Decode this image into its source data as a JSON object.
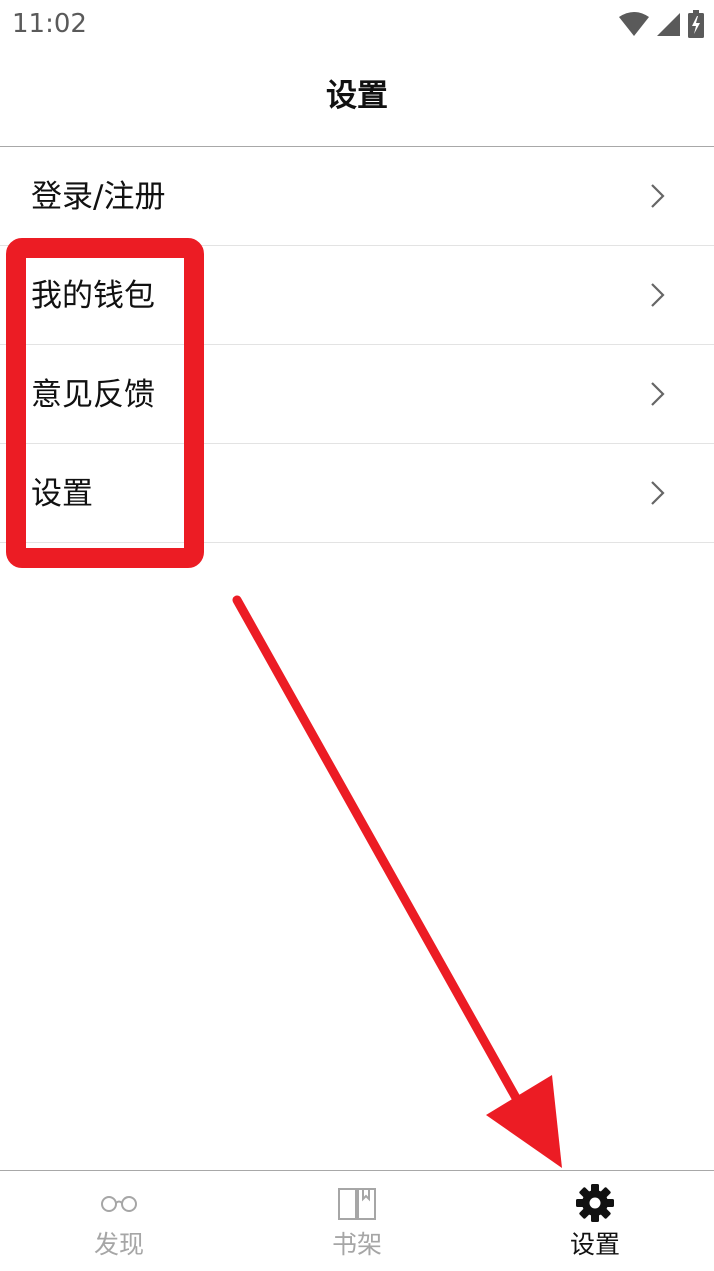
{
  "status_bar": {
    "time": "11:02",
    "icons": [
      "wifi-icon",
      "cellular-signal-icon",
      "battery-charging-icon"
    ]
  },
  "header": {
    "title": "设置"
  },
  "menu": {
    "items": [
      {
        "label": "登录/注册",
        "icon": "chevron-right-icon"
      },
      {
        "label": "我的钱包",
        "icon": "chevron-right-icon"
      },
      {
        "label": "意见反馈",
        "icon": "chevron-right-icon"
      },
      {
        "label": "设置",
        "icon": "chevron-right-icon"
      }
    ]
  },
  "tabbar": {
    "tabs": [
      {
        "label": "发现",
        "icon": "glasses-icon",
        "active": false
      },
      {
        "label": "书架",
        "icon": "book-icon",
        "active": false
      },
      {
        "label": "设置",
        "icon": "gear-icon",
        "active": true
      }
    ]
  },
  "colors": {
    "annotation": "#ec1c24",
    "inactive_tab": "#a6a6a6",
    "active_tab": "#111111",
    "divider": "#e3e3e3"
  }
}
